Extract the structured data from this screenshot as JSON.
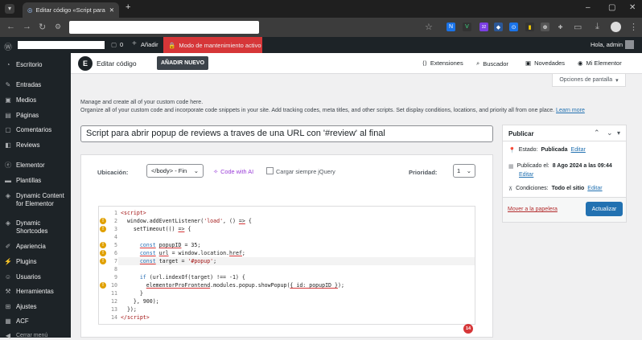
{
  "browser": {
    "tab_title": "Editar código «Script para abri",
    "new_tab": "+",
    "win_min": "–",
    "win_max": "▢",
    "win_close": "✕"
  },
  "ext": {
    "badge": "32"
  },
  "adminbar": {
    "comments": "0",
    "new": "Añadir",
    "maintenance": "Modo de mantenimiento activo",
    "greeting": "Hola, admin"
  },
  "sidebar": {
    "items": [
      "Escritorio",
      "Entradas",
      "Medios",
      "Páginas",
      "Comentarios",
      "Reviews",
      "Elementor",
      "Plantillas",
      "Dynamic Content for Elementor",
      "Dynamic Shortcodes",
      "Apariencia",
      "Plugins",
      "Usuarios",
      "Herramientas",
      "Ajustes",
      "ACF",
      "Cerrar menú"
    ]
  },
  "topbar": {
    "title": "Editar código",
    "add_new": "AÑADIR NUEVO",
    "extensions": "Extensiones",
    "search": "Buscador",
    "news": "Novedades",
    "my_elementor": "Mi Elementor",
    "screen_options": "Opciones de pantalla"
  },
  "intro": {
    "line1": "Manage and create all of your custom code here.",
    "line2": "Organize all of your custom code and incorporate code snippets in your site. Add tracking codes, meta titles, and other scripts. Set display conditions, locations, and priority all from one place.",
    "learn_more": "Learn more"
  },
  "editor": {
    "title_value": "Script para abrir popup de reviews a traves de una URL con '#review' al final",
    "location_label": "Ubicación:",
    "location_value": "</body> - Fin",
    "code_with_ai": "Code with AI",
    "jquery_label": "Cargar siempre jQuery",
    "priority_label": "Prioridad:",
    "priority_value": "1",
    "badge_count": "14"
  },
  "code_lines": [
    "1",
    "2",
    "3",
    "4",
    "5",
    "6",
    "7",
    "8",
    "9",
    "10",
    "11",
    "12",
    "13",
    "14"
  ],
  "publish": {
    "heading": "Publicar",
    "status_label": "Estado:",
    "status_value": "Publicada",
    "status_edit": "Editar",
    "published_label": "Publicado el:",
    "published_value": "8 Ago 2024 a las 09:44",
    "published_edit": "Editar",
    "conditions_label": "Condiciones:",
    "conditions_value": "Todo el sitio",
    "conditions_edit": "Editar",
    "trash": "Mover a la papelera",
    "update": "Actualizar"
  }
}
